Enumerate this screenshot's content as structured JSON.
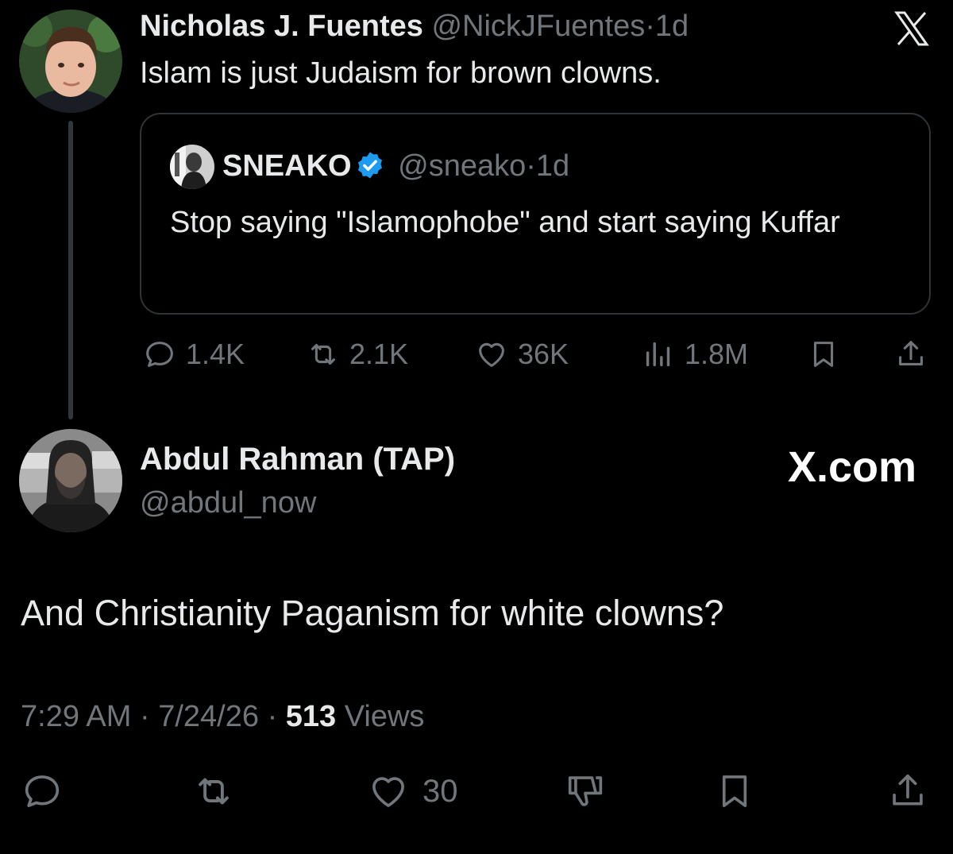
{
  "parent_tweet": {
    "display_name": "Nicholas J. Fuentes",
    "handle": "@NickJFuentes",
    "separator": "·",
    "age": "1d",
    "text": "Islam is just Judaism for brown clowns.",
    "quoted_tweet": {
      "display_name": "SNEAKO",
      "handle": "@sneako",
      "separator": "·",
      "age": "1d",
      "text": "Stop saying \"Islamophobe\" and start saying Kuffar",
      "verified": true
    },
    "actions": {
      "replies": "1.4K",
      "reposts": "2.1K",
      "likes": "36K",
      "views": "1.8M"
    }
  },
  "reply_tweet": {
    "display_name": "Abdul Rahman (TAP)",
    "handle": "@abdul_now",
    "brand": "X.com",
    "text": "And Christianity Paganism for white clowns?",
    "meta": {
      "time": "7:29 AM",
      "sep1": "·",
      "date": "7/24/26",
      "sep2": "·",
      "views_count": "513",
      "views_label": "Views"
    },
    "actions": {
      "likes": "30"
    }
  },
  "icons": {
    "top_right": "x-logo-icon",
    "reply": "speech-bubble-icon",
    "repost": "repost-arrows-icon",
    "like": "heart-icon",
    "views": "bar-chart-icon",
    "bookmark": "bookmark-icon",
    "share": "share-upload-icon",
    "dislike": "thumbs-down-icon",
    "verified": "verified-badge-icon"
  },
  "colors": {
    "background": "#000000",
    "primary_text": "#e7e9ea",
    "muted_text": "#71767b",
    "border": "#2f3336",
    "verified_blue": "#1d9bf0"
  }
}
